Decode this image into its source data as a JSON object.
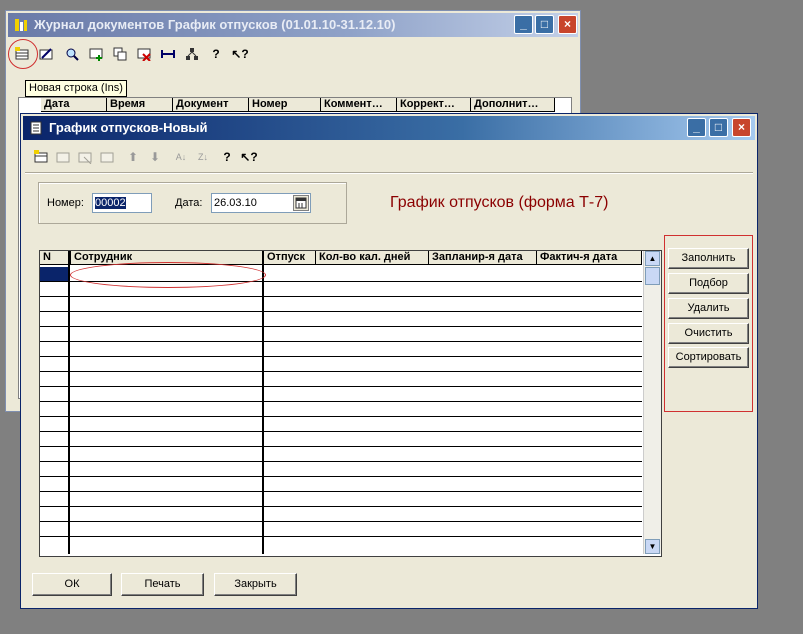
{
  "journal": {
    "title": "Журнал документов  График отпусков (01.01.10-31.12.10)",
    "tooltip": "Новая строка (Ins)",
    "columns": [
      "Дата",
      "Время",
      "Документ",
      "Номер",
      "Коммент…",
      "Коррект…",
      "Дополнит…"
    ]
  },
  "form": {
    "title": "График отпусков-Новый",
    "number_label": "Номер:",
    "number_value": "00002",
    "date_label": "Дата:",
    "date_value": "26.03.10",
    "heading": "График отпусков (форма Т-7)",
    "columns": [
      "N",
      "Сотрудник",
      "Отпуск",
      "Кол-во кал. дней",
      "Запланир-я дата",
      "Фактич-я дата"
    ],
    "side_buttons": [
      "Заполнить",
      "Подбор",
      "Удалить",
      "Очистить",
      "Сортировать"
    ],
    "bottom_buttons": [
      "ОК",
      "Печать",
      "Закрыть"
    ]
  },
  "colors": {
    "heading": "#8b0000",
    "annotation": "#d03030",
    "selection": "#0a246a"
  },
  "icons": [
    "new-row-icon",
    "edit-icon",
    "find-icon",
    "add-icon",
    "copy-icon",
    "delete-icon",
    "range-icon",
    "tree-icon",
    "help-icon",
    "whats-this-icon"
  ]
}
